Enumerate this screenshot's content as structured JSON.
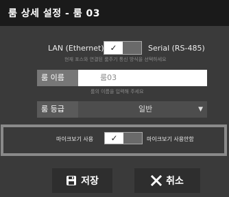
{
  "window": {
    "title": "룸 상세 설정  -  룸 03"
  },
  "connection": {
    "left_label": "LAN (Ethernet)",
    "right_label": "Serial (RS-485)",
    "toggle_glyph": "✓",
    "hint": "현재 포스와 연결된 룸주기 통신 방식을 선택하세요"
  },
  "room_name": {
    "label": "룸 이름",
    "value": "룸03",
    "hint": "룸의 이름을 입력해 주세요"
  },
  "room_grade": {
    "label": "룸 등급",
    "value": "일반",
    "arrow": "▼"
  },
  "mic": {
    "left_label": "마이크보기 사용",
    "right_label": "마이크보기 사용안함",
    "toggle_glyph": "✓"
  },
  "actions": {
    "save_label": "저장",
    "cancel_label": "취소"
  },
  "icons": {
    "save": "floppy-icon",
    "cancel": "x-icon"
  }
}
